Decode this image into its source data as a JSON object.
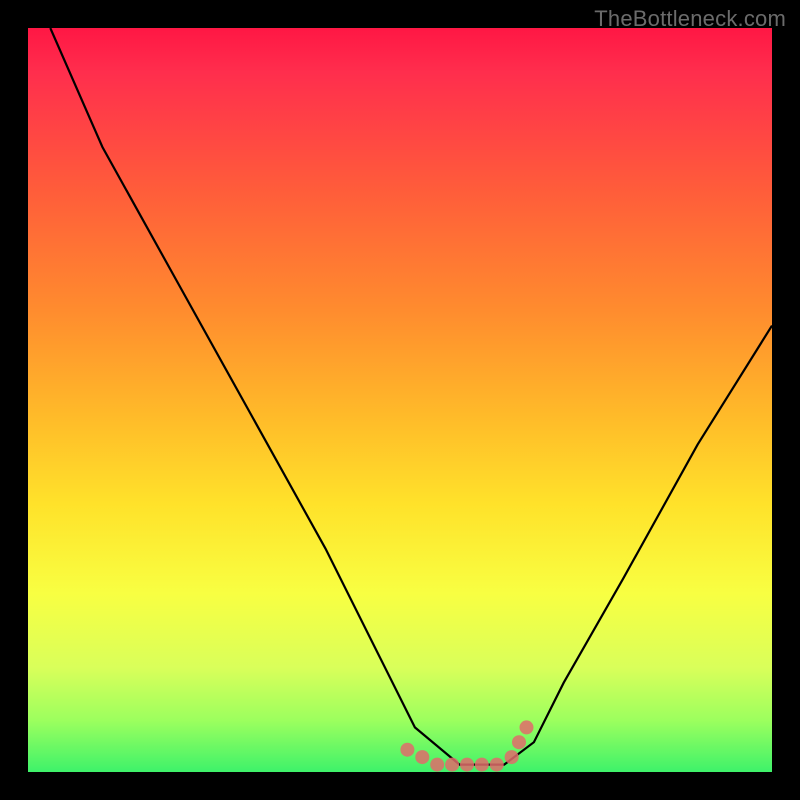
{
  "watermark": "TheBottleneck.com",
  "chart_data": {
    "type": "line",
    "title": "",
    "xlabel": "",
    "ylabel": "",
    "xlim": [
      0,
      100
    ],
    "ylim": [
      0,
      100
    ],
    "series": [
      {
        "name": "bottleneck-curve",
        "x": [
          3,
          10,
          20,
          30,
          40,
          47,
          52,
          58,
          64,
          68,
          72,
          80,
          90,
          100
        ],
        "values": [
          100,
          84,
          66,
          48,
          30,
          16,
          6,
          1,
          1,
          4,
          12,
          26,
          44,
          60
        ]
      }
    ],
    "annotations": [
      {
        "name": "valley-dots",
        "type": "dots",
        "color": "#e06b6b",
        "points_x": [
          51,
          53,
          55,
          57,
          59,
          61,
          63,
          65,
          66,
          67
        ],
        "points_y": [
          3,
          2,
          1,
          1,
          1,
          1,
          1,
          2,
          4,
          6
        ]
      }
    ],
    "gradient_stops": [
      {
        "pos": 0.0,
        "color": "#ff1744"
      },
      {
        "pos": 0.22,
        "color": "#ff5d3a"
      },
      {
        "pos": 0.52,
        "color": "#ffba29"
      },
      {
        "pos": 0.76,
        "color": "#f8ff42"
      },
      {
        "pos": 1.0,
        "color": "#3ef26a"
      }
    ]
  }
}
